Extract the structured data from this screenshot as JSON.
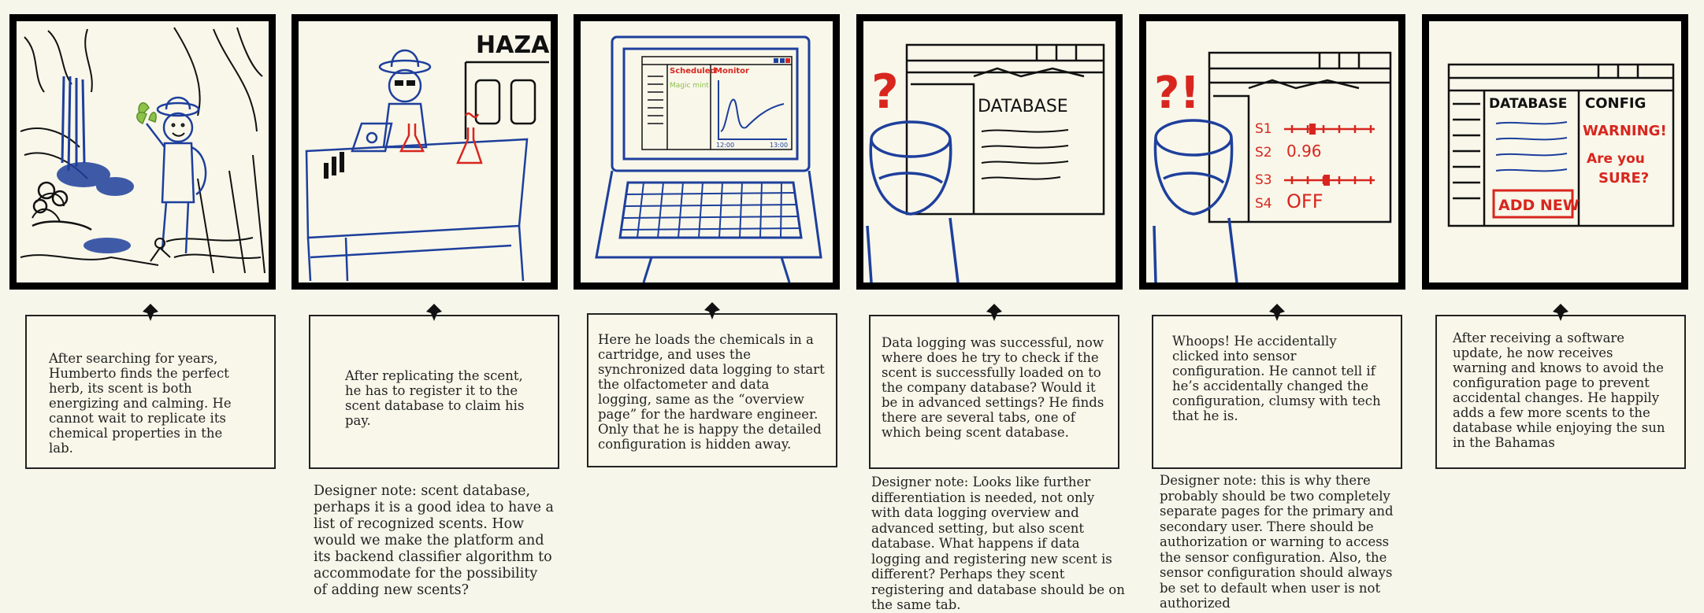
{
  "panels": [
    {
      "caption": "After searching for years, Humberto finds the perfect herb, its scent is both energizing and calming. He cannot wait to replicate its chemical properties in the lab."
    },
    {
      "caption": "After replicating the scent, he has to register it to the scent database to claim his pay.",
      "hazard_sign": "HAZARD"
    },
    {
      "caption": "Here he loads the chemicals in a cartridge, and uses the synchronized data logging to start the olfactometer and data logging, same as the “overview page” for the hardware engineer. Only that he is happy the detailed configuration is hidden away.",
      "screen": {
        "tab1": "Scheduled",
        "tab2": "Monitor",
        "list_item": "Magic mint",
        "t_start": "12:00",
        "t_end": "13:00"
      }
    },
    {
      "caption": "Data logging was successful, now where does he try to check if the scent is successfully loaded on to the company database? Would it be in advanced settings? He finds there are several tabs, one of which being scent database.",
      "screen": {
        "title": "DATABASE",
        "question": "?"
      }
    },
    {
      "caption": "Whoops! He accidentally clicked into sensor configuration. He cannot tell if he’s accidentally changed the configuration, clumsy with tech that he is.",
      "screen": {
        "question": "?!",
        "s1": "S1",
        "s2": "S2",
        "s2_value": "0.96",
        "s3": "S3",
        "s4": "S4",
        "s4_value": "OFF"
      }
    },
    {
      "caption": "After receiving a software update, he now receives warning and knows to avoid the configuration page to prevent accidental changes. He happily adds a few more scents to the database while enjoying the sun in the Bahamas",
      "screen": {
        "db_title": "DATABASE",
        "config_title": "CONFIG",
        "warning": "WARNING!",
        "are_you_sure_1": "Are you",
        "are_you_sure_2": "SURE?",
        "add_new": "ADD NEW"
      }
    }
  ],
  "designer_notes": {
    "panel2": "Designer note: scent database, perhaps it is a good idea to have a list of recognized scents. How would we make the platform and its backend classifier algorithm to accommodate for the possibility of adding new scents?",
    "panel4": "Designer note: Looks like further differentiation is needed, not only with data logging overview and advanced setting, but also scent database. What happens if data logging and registering new scent is different? Perhaps they scent registering and database should be on the same tab.",
    "panel5": "Designer note: this is why there probably should be two completely separate pages for the primary and secondary user. There should be authorization or warning to access the sensor configuration. Also, the sensor configuration should always be set to default when user is not authorized"
  },
  "colors": {
    "ink": "#111111",
    "blue": "#1e3f9c",
    "red": "#d8261e",
    "green": "#8dc24a",
    "paper": "#f8f7ea"
  }
}
